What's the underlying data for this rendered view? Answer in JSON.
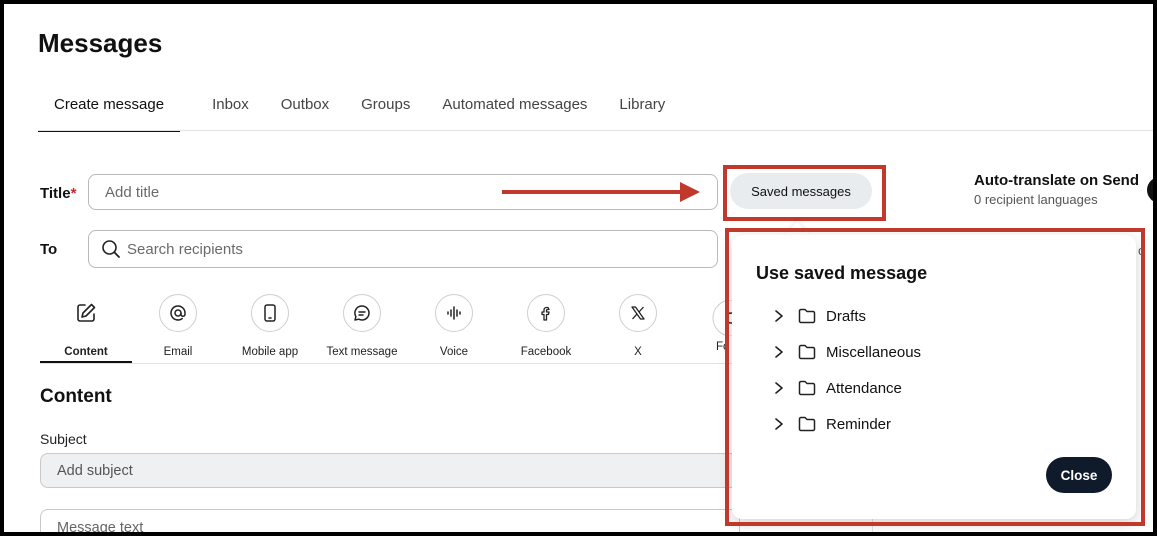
{
  "page": {
    "title": "Messages"
  },
  "tabs": [
    {
      "label": "Create message",
      "active": true
    },
    {
      "label": "Inbox"
    },
    {
      "label": "Outbox"
    },
    {
      "label": "Groups"
    },
    {
      "label": "Automated messages"
    },
    {
      "label": "Library"
    }
  ],
  "form": {
    "title_label": "Title",
    "required_mark": "*",
    "title_placeholder": "Add title",
    "to_label": "To",
    "search_placeholder": "Search recipients",
    "saved_messages_label": "Saved messages"
  },
  "auto_translate": {
    "title": "Auto-translate on Send",
    "subtitle": "0 recipient languages",
    "peek_text": "c"
  },
  "channels": [
    {
      "label": "Content",
      "icon": "edit-icon",
      "active": true
    },
    {
      "label": "Email",
      "icon": "at-icon"
    },
    {
      "label": "Mobile app",
      "icon": "phone-icon"
    },
    {
      "label": "Text message",
      "icon": "chat-icon"
    },
    {
      "label": "Voice",
      "icon": "voice-icon"
    },
    {
      "label": "Facebook",
      "icon": "facebook-icon"
    },
    {
      "label": "X",
      "icon": "x-icon"
    },
    {
      "label": "Fo",
      "icon": "partial-icon"
    }
  ],
  "content": {
    "section_title": "Content",
    "subject_label": "Subject",
    "subject_placeholder": "Add subject",
    "message_placeholder": "Message text"
  },
  "popover": {
    "title": "Use saved message",
    "folders": [
      "Drafts",
      "Miscellaneous",
      "Attendance",
      "Reminder"
    ],
    "close_label": "Close"
  },
  "colors": {
    "highlight": "#c0392b",
    "close_button": "#0f1b2a"
  }
}
